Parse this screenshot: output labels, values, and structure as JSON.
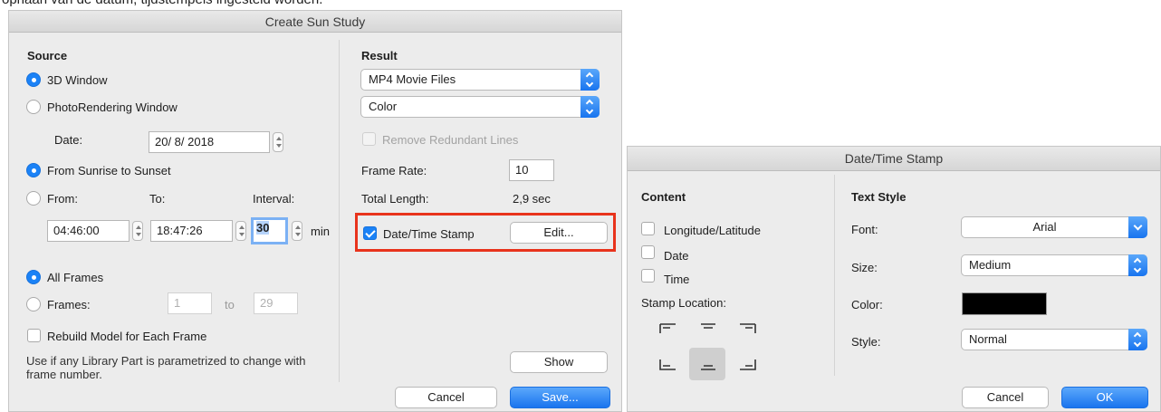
{
  "caption": "opnaan van de datum, tijdstempels ingesteld worden.",
  "sun_study": {
    "title": "Create Sun Study",
    "source": {
      "heading": "Source",
      "radio_3d": "3D Window",
      "radio_photo": "PhotoRendering Window",
      "date_label": "Date:",
      "date_value": "20/ 8/ 2018",
      "radio_sunrise": "From Sunrise to Sunset",
      "radio_from": "From:",
      "to_label": "To:",
      "interval_label": "Interval:",
      "from_value": "04:46:00",
      "to_value": "18:47:26",
      "interval_value": "30",
      "min_label": "min",
      "radio_all_frames": "All Frames",
      "radio_frames": "Frames:",
      "frames_from": "1",
      "frames_to_label": "to",
      "frames_to": "29",
      "rebuild_label": "Rebuild Model for Each Frame",
      "note": "Use if any Library Part is parametrized to change with frame number."
    },
    "result": {
      "heading": "Result",
      "format_value": "MP4 Movie Files",
      "color_value": "Color",
      "remove_lines_label": "Remove Redundant Lines",
      "frame_rate_label": "Frame Rate:",
      "frame_rate_value": "10",
      "total_length_label": "Total Length:",
      "total_length_value": "2,9 sec",
      "stamp_label": "Date/Time Stamp",
      "edit_label": "Edit...",
      "show_label": "Show"
    },
    "cancel_label": "Cancel",
    "save_label": "Save..."
  },
  "stamp_dialog": {
    "title": "Date/Time Stamp",
    "content": {
      "heading": "Content",
      "longlat_label": "Longitude/Latitude",
      "date_label": "Date",
      "time_label": "Time",
      "location_label": "Stamp Location:"
    },
    "text_style": {
      "heading": "Text Style",
      "font_label": "Font:",
      "font_value": "Arial",
      "size_label": "Size:",
      "size_value": "Medium",
      "color_label": "Color:",
      "color_value": "#000000",
      "style_label": "Style:",
      "style_value": "Normal"
    },
    "cancel_label": "Cancel",
    "ok_label": "OK"
  },
  "colors": {
    "accent": "#1b82f6",
    "highlight_border": "#e8331c",
    "dialog_bg": "#ececec"
  }
}
